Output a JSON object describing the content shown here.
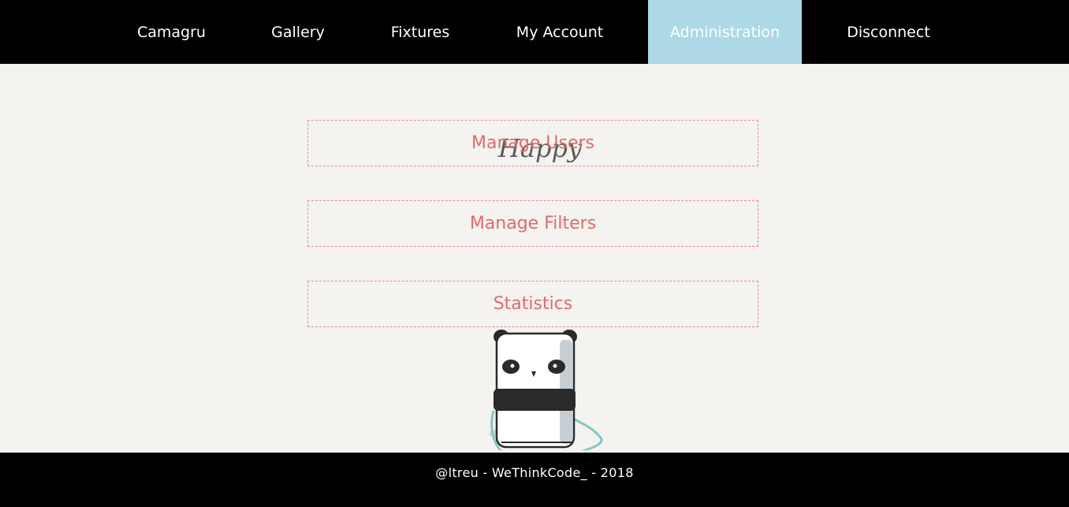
{
  "nav": {
    "items": [
      {
        "label": "Camagru"
      },
      {
        "label": "Gallery"
      },
      {
        "label": "Fixtures"
      },
      {
        "label": "My Account"
      },
      {
        "label": "Administration",
        "active": true
      },
      {
        "label": "Disconnect"
      }
    ]
  },
  "illustration": {
    "caption": "Happy"
  },
  "admin": {
    "links": [
      {
        "label": "Manage Users"
      },
      {
        "label": "Manage Filters"
      },
      {
        "label": "Statistics"
      }
    ]
  },
  "footer": {
    "text": "@ltreu - WeThinkCode_ - 2018"
  },
  "colors": {
    "nav_bg": "#000000",
    "active_bg": "#add8e6",
    "page_bg": "#f4f3ef",
    "link_text": "#e26a6a",
    "link_border": "#ee8c8c"
  }
}
